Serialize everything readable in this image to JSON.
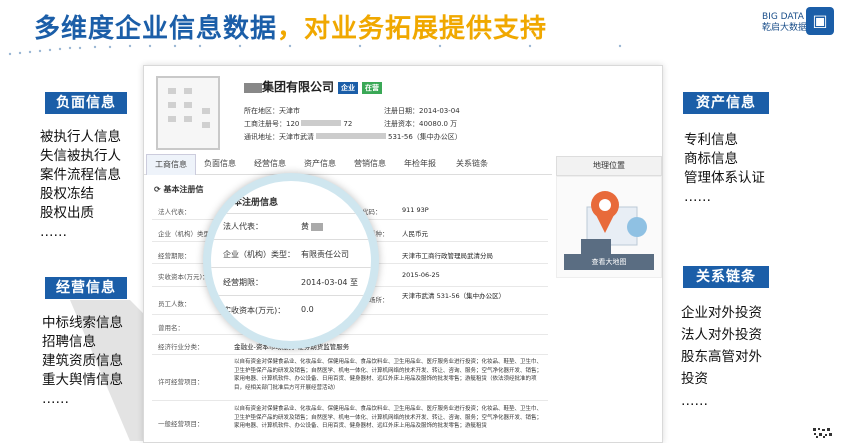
{
  "header": {
    "title_main": "多维度企业信息数据",
    "title_accent": "，对业务拓展提供支持",
    "logo_line1": "BIG DATA",
    "logo_line2": "乾启大数据"
  },
  "left_sections": [
    {
      "label": "负面信息",
      "items": [
        "被执行人信息",
        "失信被执行人",
        "案件流程信息",
        "股权冻结",
        "股权出质",
        "……"
      ]
    },
    {
      "label": "经营信息",
      "items": [
        "中标线索信息",
        "招聘信息",
        "建筑资质信息",
        "重大舆情信息",
        "……"
      ]
    }
  ],
  "right_sections": [
    {
      "label": "资产信息",
      "items": [
        "专利信息",
        "商标信息",
        "管理体系认证",
        "……"
      ]
    },
    {
      "label": "关系链条",
      "items": [
        "企业对外投资",
        "法人对外投资",
        "股东高管对外",
        "投资",
        "……"
      ]
    }
  ],
  "company": {
    "name": "集团有限公司",
    "badge1": "企业",
    "badge2": "在营",
    "region_label": "所在地区：天津市",
    "reg_no_label": "工商注册号：120",
    "reg_no_tail": "72",
    "address_label": "通讯地址：天津市武清",
    "address_tail": "531-56（集中办公区）",
    "reg_date": "注册日期：2014-03-04",
    "reg_capital": "注册资本：40080.0 万"
  },
  "tabs": [
    "工商信息",
    "负面信息",
    "经营信息",
    "资产信息",
    "营销信息",
    "年检年报",
    "关系链条"
  ],
  "section_title": "基本注册信",
  "section_title_mag": "本注册信息",
  "table_rows": [
    {
      "label": "法人代表：",
      "value": "",
      "label2": "社会信用代码：",
      "value2": "911               93P"
    },
    {
      "label": "企业（机构）类型",
      "value": "",
      "label2": "币种：",
      "value2": "人民币元"
    },
    {
      "label": "经营期限：",
      "value": "",
      "label2": "",
      "value2": "天津市工商行政管理局武清分局"
    },
    {
      "label": "实收资本(万元)：",
      "value": "",
      "label2": "",
      "value2": "2015-06-25"
    },
    {
      "label": "员工人数：",
      "value": "",
      "label2": "场所：",
      "value2": "天津市武清              531-56（集中办公区）"
    },
    {
      "label": "曾用名：",
      "value": "",
      "label2": "",
      "value2": ""
    },
    {
      "label": "经济行业分类：",
      "value": "金融业-资本市场服务-证券期货监管服务",
      "label2": "",
      "value2": ""
    }
  ],
  "license_rows": [
    {
      "label": "许可经营项目：",
      "text": "以自有资金对保健食品业、化妆品业、保健用品业、食品饮料业、卫生用品业、医疗服务业进行投资；化妆品、鞋垫、卫生巾、卫生护垫保产品的研发及销售；自然医学、机电一体化、计算机网络的技术开发、转让、咨询、服务；空气净化器开发、销售；家用电器、计算机软件、办公设备、日用百货、健身器材、远红外床上用品及服饰的批发零售；游艇租赁（依法须经批准的项目，经相关部门批准后方可开展经营活动）"
    },
    {
      "label": "一般经营项目：",
      "text": "以自有资金对保健食品业、化妆品业、保健用品业、食品饮料业、卫生用品业、医疗服务业进行投资；化妆品、鞋垫、卫生巾、卫生护垫保产品的研发及销售；自然医学、机电一体化、计算机网络的技术开发、转让、咨询、服务；空气净化器开发、销售；家用电器、计算机软件、办公设备、日用百货、健身器材、远红外床上用品及服饰的批发零售；游艇租赁"
    }
  ],
  "magnifier": {
    "rows": [
      {
        "label": "法人代表：",
        "value": "黄"
      },
      {
        "label": "企业（机构）类型：",
        "value": "有限责任公司"
      },
      {
        "label": "经营期限：",
        "value": "2014-03-04 至"
      },
      {
        "label": "实收资本(万元)：",
        "value": "0.0"
      }
    ]
  },
  "map": {
    "header": "地理位置",
    "button": "查看大地图"
  },
  "colors": {
    "brand": "#1b5ea8",
    "accent": "#f0a800"
  }
}
